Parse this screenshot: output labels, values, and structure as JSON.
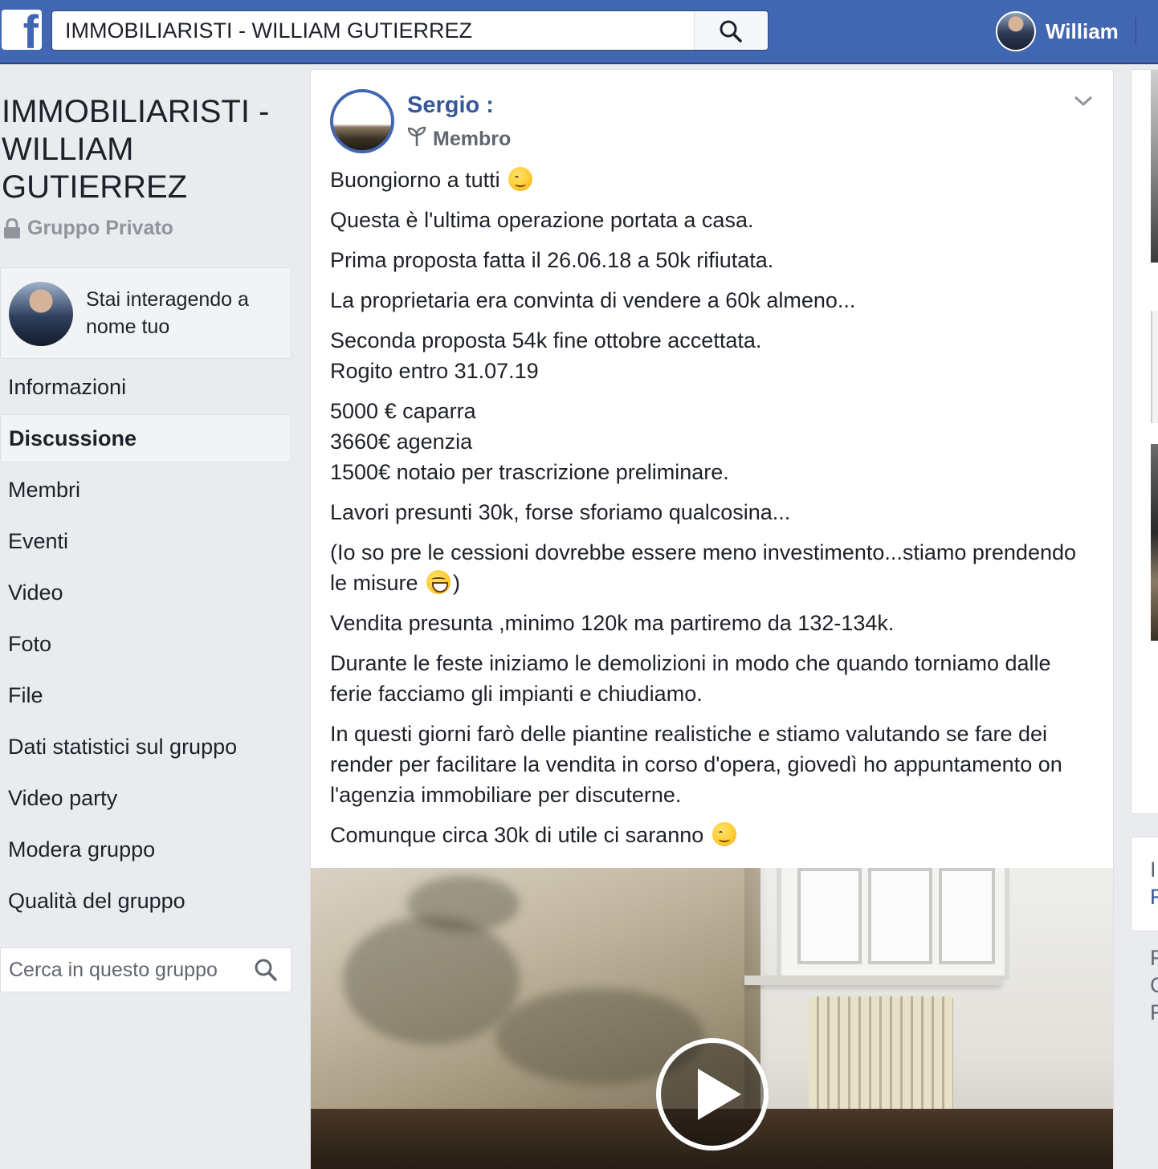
{
  "header": {
    "logo": "f",
    "search_value": "IMMOBILIARISTI - WILLIAM GUTIERREZ",
    "user_name": "William"
  },
  "group": {
    "title": "IMMOBILIARISTI - WILLIAM GUTIERREZ",
    "privacy": "Gruppo Privato"
  },
  "interacting": {
    "text": "Stai interagendo a nome tuo"
  },
  "nav": {
    "items": [
      {
        "label": "Informazioni"
      },
      {
        "label": "Discussione"
      },
      {
        "label": "Membri"
      },
      {
        "label": "Eventi"
      },
      {
        "label": "Video"
      },
      {
        "label": "Foto"
      },
      {
        "label": "File"
      },
      {
        "label": "Dati statistici sul gruppo"
      },
      {
        "label": "Video party"
      },
      {
        "label": "Modera gruppo"
      },
      {
        "label": "Qualità del gruppo"
      }
    ],
    "active": "Discussione"
  },
  "group_search": {
    "placeholder": "Cerca in questo gruppo"
  },
  "post": {
    "author": "Sergio :",
    "role": "Membro",
    "paragraphs": [
      "Buongiorno a tutti",
      "Questa è l'ultima operazione portata a casa.",
      "Prima proposta fatta il 26.06.18 a 50k rifiutata.",
      "La proprietaria era convinta di vendere a 60k almeno...",
      "Seconda proposta 54k fine ottobre accettata.\nRogito entro 31.07.19",
      "5000 € caparra\n3660€ agenzia\n1500€ notaio per trascrizione preliminare.",
      "Lavori presunti 30k, forse sforiamo qualcosina...",
      "(Io so pre le cessioni dovrebbe essere meno investimento...stiamo prendendo le misure",
      "Vendita presunta ,minimo 120k ma partiremo da 132-134k.",
      "Durante le feste iniziamo le demolizioni in modo che quando torniamo dalle ferie facciamo gli impianti e chiudiamo.",
      "In questi giorni farò delle piantine realistiche e stiamo valutando se fare dei render per facilitare la vendita in corso d'opera, giovedì ho appuntamento on l'agenzia immobiliare per discuterne.",
      "Comunque circa 30k di utile ci saranno"
    ],
    "paren_close": ")"
  },
  "right_column": {
    "line1": "I",
    "line2": "F",
    "line3": "F",
    "line4": "C",
    "line5": "F"
  },
  "colors": {
    "brand_blue": "#4267b2",
    "link_blue": "#385898",
    "page_bg": "#e9ebee"
  },
  "icons": {
    "search": "search-icon",
    "lock": "lock-icon",
    "sprout": "sprout-icon",
    "chevron": "chevron-down-icon",
    "play": "play-icon"
  }
}
